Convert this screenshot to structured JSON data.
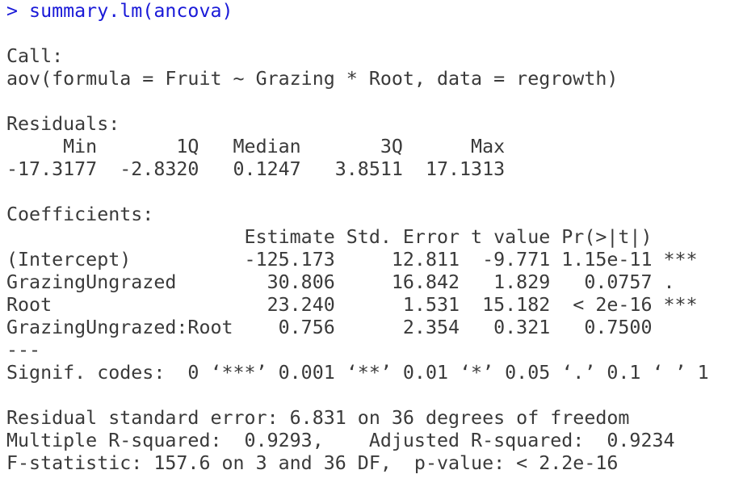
{
  "prompt_line": "> summary.lm(ancova)",
  "call": {
    "label": "Call:",
    "formula": "aov(formula = Fruit ~ Grazing * Root, data = regrowth)"
  },
  "residuals": {
    "label": "Residuals:",
    "header": "     Min       1Q   Median       3Q      Max ",
    "values": "-17.3177  -2.8320   0.1247   3.8511  17.1313 "
  },
  "coefficients": {
    "label": "Coefficients:",
    "header": "                     Estimate Std. Error t value Pr(>|t|)    ",
    "rows": [
      "(Intercept)          -125.173     12.811  -9.771 1.15e-11 ***",
      "GrazingUngrazed        30.806     16.842   1.829   0.0757 .  ",
      "Root                   23.240      1.531  15.182  < 2e-16 ***",
      "GrazingUngrazed:Root    0.756      2.354   0.321   0.7500    "
    ],
    "separator": "---",
    "signif_codes": "Signif. codes:  0 ‘***’ 0.001 ‘**’ 0.01 ‘*’ 0.05 ‘.’ 0.1 ‘ ’ 1"
  },
  "fit": {
    "residual_se": "Residual standard error: 6.831 on 36 degrees of freedom",
    "r_squared": "Multiple R-squared:  0.9293,\tAdjusted R-squared:  0.9234 ",
    "f_statistic": "F-statistic: 157.6 on 3 and 36 DF,  p-value: < 2.2e-16"
  }
}
